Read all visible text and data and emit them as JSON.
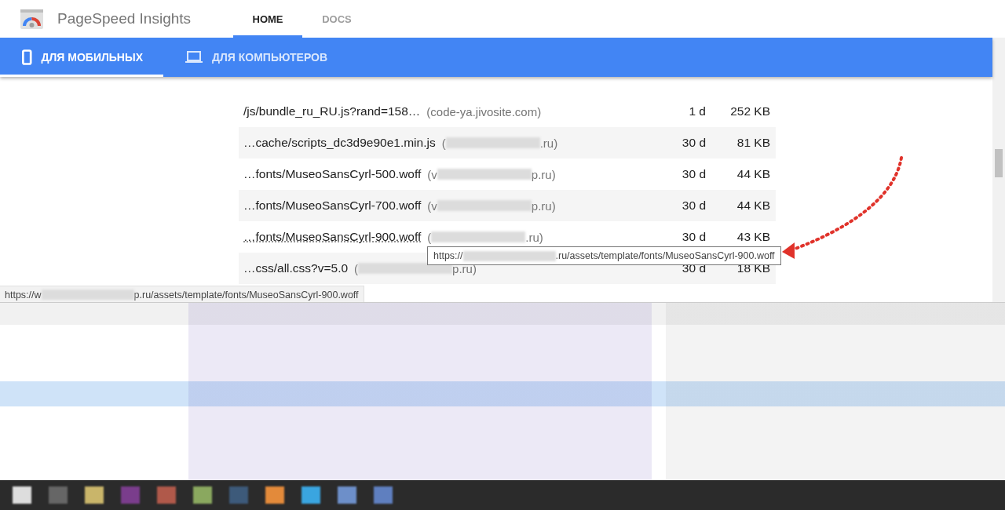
{
  "header": {
    "title": "PageSpeed Insights",
    "tabs": [
      {
        "label": "HOME",
        "selected": true
      },
      {
        "label": "DOCS",
        "selected": false
      }
    ]
  },
  "device_tabs": [
    {
      "label": "ДЛЯ МОБИЛЬНЫХ",
      "kind": "phone",
      "selected": true
    },
    {
      "label": "ДЛЯ КОМПЬЮТЕРОВ",
      "kind": "laptop",
      "selected": false
    }
  ],
  "rows": [
    {
      "url": "/js/bundle_ru_RU.js?rand=158…",
      "host_start": "(code-ya.jivosite.com)",
      "redacted": false,
      "host_end": "",
      "ttl": "1 d",
      "size": "252 KB",
      "hovered": false
    },
    {
      "url": "…cache/scripts_dc3d9e90e1.min.js",
      "host_start": "(",
      "redacted": true,
      "host_end": ".ru)",
      "ttl": "30 d",
      "size": "81 KB",
      "hovered": false
    },
    {
      "url": "…fonts/MuseoSansCyrl-500.woff",
      "host_start": "(v",
      "redacted": true,
      "host_end": "p.ru)",
      "ttl": "30 d",
      "size": "44 KB",
      "hovered": false
    },
    {
      "url": "…fonts/MuseoSansCyrl-700.woff",
      "host_start": "(v",
      "redacted": true,
      "host_end": "p.ru)",
      "ttl": "30 d",
      "size": "44 KB",
      "hovered": false
    },
    {
      "url": "…fonts/MuseoSansCyrl-900.woff",
      "host_start": "(",
      "redacted": true,
      "host_end": ".ru)",
      "ttl": "30 d",
      "size": "43 KB",
      "hovered": true
    },
    {
      "url": "…css/all.css?v=5.0",
      "host_start": "(",
      "redacted": true,
      "host_end": "p.ru)",
      "ttl": "30 d",
      "size": "18 KB",
      "hovered": false
    }
  ],
  "tooltip": {
    "start": "https://",
    "end": ".ru/assets/template/fonts/MuseoSansCyrl-900.woff"
  },
  "status_bar": {
    "start": "https://w",
    "end": "p.ru/assets/template/fonts/MuseoSansCyrl-900.woff"
  }
}
